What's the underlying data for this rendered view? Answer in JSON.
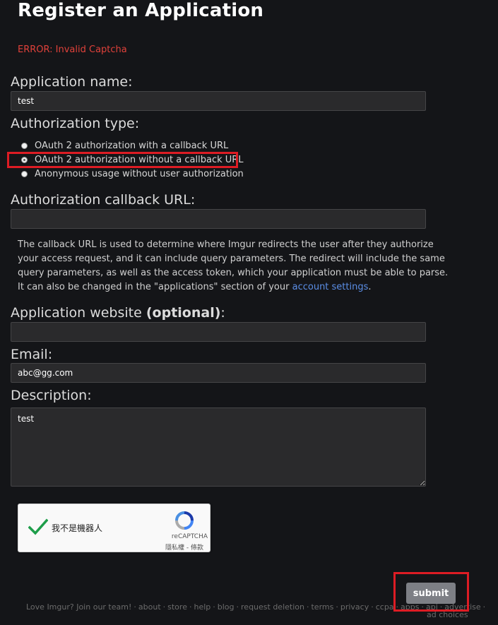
{
  "page": {
    "title": "Register an Application",
    "error": "ERROR: Invalid Captcha"
  },
  "form": {
    "app_name_label": "Application name:",
    "app_name_value": "test",
    "auth_type_label": "Authorization type:",
    "auth_options": [
      "OAuth 2 authorization with a callback URL",
      "OAuth 2 authorization without a callback URL",
      "Anonymous usage without user authorization"
    ],
    "auth_selected": 1,
    "callback_label": "Authorization callback URL:",
    "callback_value": "",
    "callback_help": "The callback URL is used to determine where Imgur redirects the user after they authorize your access request, and it can include query parameters. The redirect will include the same query parameters, as well as the access token, which your application must be able to parse. It can also be changed in the \"applications\" section of your ",
    "callback_help_link": "account settings",
    "callback_help_end": ".",
    "website_label": "Application website ",
    "website_optional": "(optional)",
    "website_colon": ":",
    "website_value": "",
    "email_label": "Email:",
    "email_value": "abc@gg.com",
    "description_label": "Description:",
    "description_value": "test"
  },
  "captcha": {
    "label": "我不是機器人",
    "brand": "reCAPTCHA",
    "links": "隱私權 - 條款",
    "checkmark_color": "#1e9e4a"
  },
  "submit_label": "submit",
  "footer": {
    "items": [
      "Love Imgur? Join our team!",
      "about",
      "store",
      "help",
      "blog",
      "request deletion",
      "terms",
      "privacy",
      "ccpa",
      "apps",
      "api",
      "advertise",
      "ad choices"
    ]
  },
  "colors": {
    "background": "#141518",
    "error": "#e0413a",
    "highlight": "#dd1c24",
    "link": "#5b8ee6"
  }
}
